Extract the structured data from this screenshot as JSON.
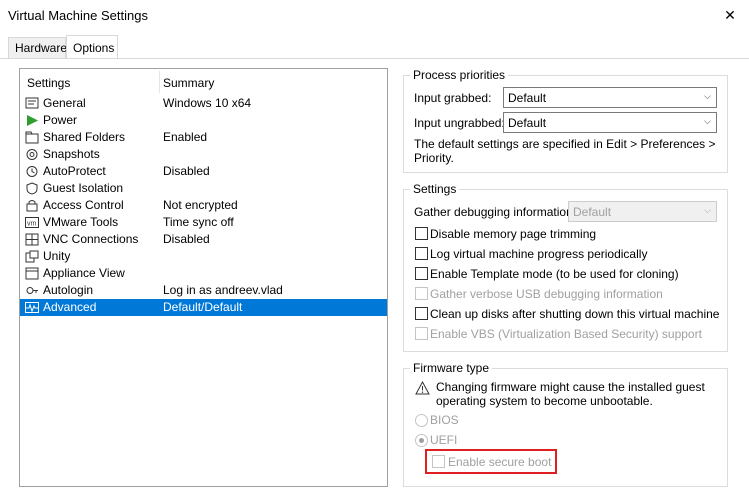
{
  "window": {
    "title": "Virtual Machine Settings",
    "close_glyph": "✕"
  },
  "tabs": [
    {
      "label": "Hardware"
    },
    {
      "label": "Options"
    }
  ],
  "list": {
    "headers": {
      "settings": "Settings",
      "summary": "Summary"
    },
    "items": [
      {
        "name": "General",
        "summary": "Windows 10 x64",
        "icon": "general-icon"
      },
      {
        "name": "Power",
        "summary": "",
        "icon": "power-icon"
      },
      {
        "name": "Shared Folders",
        "summary": "Enabled",
        "icon": "shared-folders-icon"
      },
      {
        "name": "Snapshots",
        "summary": "",
        "icon": "snapshots-icon"
      },
      {
        "name": "AutoProtect",
        "summary": "Disabled",
        "icon": "autoprotect-icon"
      },
      {
        "name": "Guest Isolation",
        "summary": "",
        "icon": "guest-isolation-icon"
      },
      {
        "name": "Access Control",
        "summary": "Not encrypted",
        "icon": "access-control-icon"
      },
      {
        "name": "VMware Tools",
        "summary": "Time sync off",
        "icon": "vmware-tools-icon"
      },
      {
        "name": "VNC Connections",
        "summary": "Disabled",
        "icon": "vnc-connections-icon"
      },
      {
        "name": "Unity",
        "summary": "",
        "icon": "unity-icon"
      },
      {
        "name": "Appliance View",
        "summary": "",
        "icon": "appliance-view-icon"
      },
      {
        "name": "Autologin",
        "summary": "Log in as andreev.vlad",
        "icon": "autologin-icon"
      },
      {
        "name": "Advanced",
        "summary": "Default/Default",
        "icon": "advanced-icon",
        "selected": true
      }
    ]
  },
  "process_priorities": {
    "title": "Process priorities",
    "input_grabbed_label": "Input grabbed:",
    "input_grabbed_value": "Default",
    "input_ungrabbed_label": "Input ungrabbed:",
    "input_ungrabbed_value": "Default",
    "note_line1": "The default settings are specified in Edit > Preferences >",
    "note_line2": "Priority."
  },
  "settings_group": {
    "title": "Settings",
    "gather_label": "Gather debugging information:",
    "gather_value": "Default",
    "checkboxes": [
      {
        "label": "Disable memory page trimming",
        "checked": false,
        "enabled": true
      },
      {
        "label": "Log virtual machine progress periodically",
        "checked": false,
        "enabled": true
      },
      {
        "label": "Enable Template mode (to be used for cloning)",
        "checked": false,
        "enabled": true
      },
      {
        "label": "Gather verbose USB debugging information",
        "checked": false,
        "enabled": false
      },
      {
        "label": "Clean up disks after shutting down this virtual machine",
        "checked": false,
        "enabled": true
      },
      {
        "label": "Enable VBS (Virtualization Based Security) support",
        "checked": false,
        "enabled": false
      }
    ]
  },
  "firmware": {
    "title": "Firmware type",
    "warning_line1": "Changing firmware might cause the installed guest",
    "warning_line2": "operating system to become unbootable.",
    "bios_label": "BIOS",
    "uefi_label": "UEFI",
    "selected": "UEFI",
    "secure_boot_label": "Enable secure boot",
    "secure_boot_checked": false
  },
  "colors": {
    "selection": "#0078d7",
    "highlight_box": "#e02020"
  }
}
